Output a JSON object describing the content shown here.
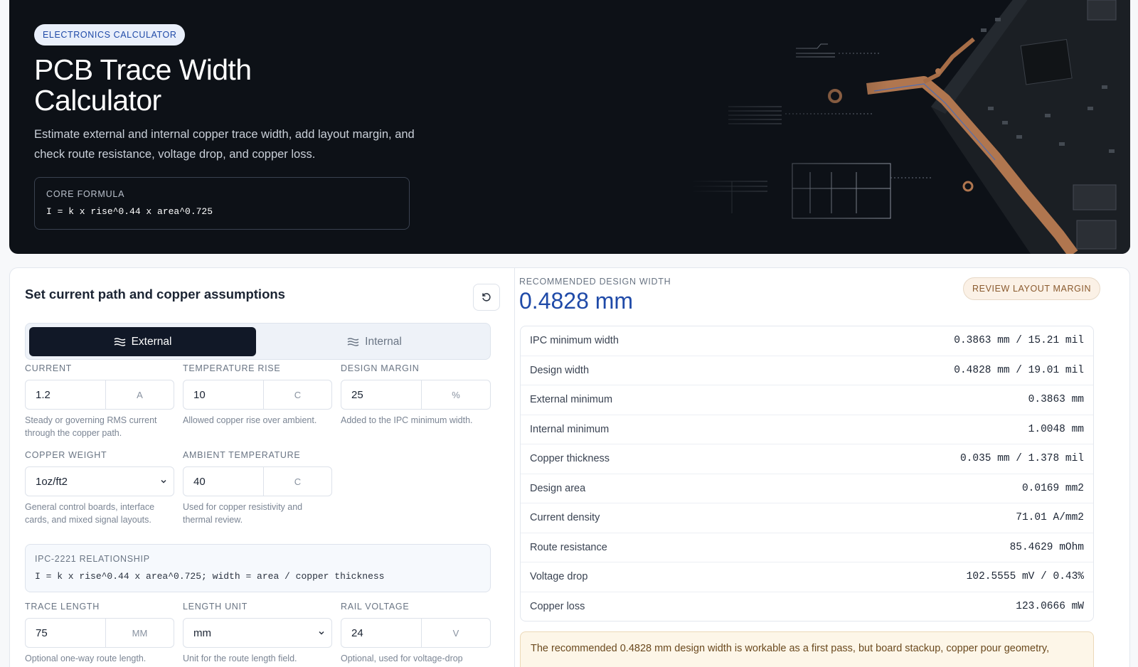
{
  "hero": {
    "badge": "ELECTRONICS CALCULATOR",
    "title": "PCB Trace Width Calculator",
    "subtitle": "Estimate external and internal copper trace width, add layout margin, and check route resistance, voltage drop, and copper loss.",
    "formula_label": "CORE FORMULA",
    "formula": "I = k x rise^0.44 x area^0.725"
  },
  "inputs": {
    "panel_title": "Set current path and copper assumptions",
    "reset_icon": "refresh-icon",
    "layer_toggle": {
      "external": "External",
      "internal": "Internal",
      "selected": "External"
    },
    "current": {
      "label": "CURRENT",
      "value": "1.2",
      "unit": "A",
      "help": "Steady or governing RMS current through the copper path."
    },
    "temperature_rise": {
      "label": "TEMPERATURE RISE",
      "value": "10",
      "unit": "C",
      "help": "Allowed copper rise over ambient."
    },
    "design_margin": {
      "label": "DESIGN MARGIN",
      "value": "25",
      "unit": "%",
      "help": "Added to the IPC minimum width."
    },
    "copper_weight": {
      "label": "COPPER WEIGHT",
      "value": "1oz/ft2",
      "help": "General control boards, interface cards, and mixed signal layouts."
    },
    "ambient_temperature": {
      "label": "AMBIENT TEMPERATURE",
      "value": "40",
      "unit": "C",
      "help": "Used for copper resistivity and thermal review."
    },
    "relationship": {
      "label": "IPC-2221 RELATIONSHIP",
      "formula": "I = k x rise^0.44 x area^0.725; width = area / copper thickness"
    },
    "trace_length": {
      "label": "TRACE LENGTH",
      "value": "75",
      "unit": "MM",
      "help": "Optional one-way route length."
    },
    "length_unit": {
      "label": "LENGTH UNIT",
      "value": "mm",
      "help": "Unit for the route length field."
    },
    "rail_voltage": {
      "label": "RAIL VOLTAGE",
      "value": "24",
      "unit": "V",
      "help": "Optional, used for voltage-drop"
    }
  },
  "results": {
    "recommended_label": "RECOMMENDED DESIGN WIDTH",
    "recommended_value": "0.4828 mm",
    "status_badge": "REVIEW LAYOUT MARGIN",
    "rows": [
      {
        "label": "IPC minimum width",
        "value": "0.3863 mm / 15.21 mil"
      },
      {
        "label": "Design width",
        "value": "0.4828 mm / 19.01 mil"
      },
      {
        "label": "External minimum",
        "value": "0.3863 mm"
      },
      {
        "label": "Internal minimum",
        "value": "1.0048 mm"
      },
      {
        "label": "Copper thickness",
        "value": "0.035 mm / 1.378 mil"
      },
      {
        "label": "Design area",
        "value": "0.0169 mm2"
      },
      {
        "label": "Current density",
        "value": "71.01 A/mm2"
      },
      {
        "label": "Route resistance",
        "value": "85.4629 mOhm"
      },
      {
        "label": "Voltage drop",
        "value": "102.5555 mV / 0.43%"
      },
      {
        "label": "Copper loss",
        "value": "123.0666 mW"
      }
    ],
    "notice": "The recommended 0.4828 mm design width is workable as a first pass, but board stackup, copper pour geometry,"
  },
  "colors": {
    "hero_bg": "#0d1117",
    "accent": "#1f4aa8",
    "copper": "#b0764f",
    "warning_bg": "#fdf6e8"
  }
}
